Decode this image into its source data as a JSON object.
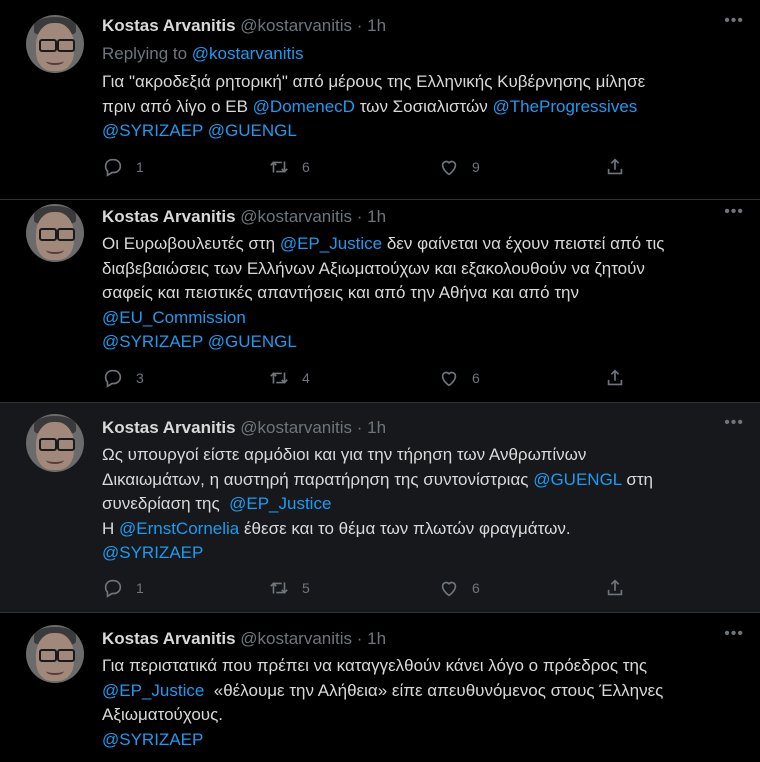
{
  "tweets": [
    {
      "name": "Kostas Arvanitis",
      "handle": "@kostarvanitis",
      "time": "1h",
      "replying_label": "Replying to",
      "replying_to": "@kostarvanitis",
      "lines": [
        [
          "Για \"ακροδεξιά ρητορική\" από μέρους της Ελληνικής Κυβέρνησης μίλησε"
        ],
        [
          "πριν από λίγο ο ΕΒ ",
          "@DomenecD",
          " των Σοσιαλιστών ",
          "@TheProgressives"
        ],
        [
          "",
          "@SYRIZAEP",
          " ",
          "@GUENGL"
        ]
      ],
      "replies": "1",
      "retweets": "6",
      "likes": "9"
    },
    {
      "name": "Kostas Arvanitis",
      "handle": "@kostarvanitis",
      "time": "1h",
      "lines": [
        [
          "Οι Ευρωβουλευτές στη ",
          "@EP_Justice",
          " δεν φαίνεται να έχουν πειστεί από τις"
        ],
        [
          "διαβεβαιώσεις των Ελλήνων Αξιωματούχων και εξακολουθούν να ζητούν"
        ],
        [
          "σαφείς και πειστικές απαντήσεις και από την Αθήνα και από την"
        ],
        [
          "",
          "@EU_Commission"
        ],
        [
          "",
          "@SYRIZAEP",
          " ",
          "@GUENGL"
        ]
      ],
      "replies": "3",
      "retweets": "4",
      "likes": "6"
    },
    {
      "name": "Kostas Arvanitis",
      "handle": "@kostarvanitis",
      "time": "1h",
      "lines": [
        [
          "Ως υπουργοί είστε αρμόδιοι και για την τήρηση των Ανθρωπίνων"
        ],
        [
          "Δικαιωμάτων, η αυστηρή παρατήρηση της συντονίστριας ",
          "@GUENGL",
          " στη"
        ],
        [
          "συνεδρίαση της  ",
          "@EP_Justice"
        ],
        [
          "Η ",
          "@ErnstCornelia",
          " έθεσε και το θέμα των πλωτών φραγμάτων."
        ],
        [
          "",
          "@SYRIZAEP"
        ]
      ],
      "replies": "1",
      "retweets": "5",
      "likes": "6"
    },
    {
      "name": "Kostas Arvanitis",
      "handle": "@kostarvanitis",
      "time": "1h",
      "lines": [
        [
          "Για περιστατικά που πρέπει να καταγγελθούν κάνει λόγο ο πρόεδρος της"
        ],
        [
          "",
          "@EP_Justice",
          "  «θέλουμε την Αλήθεια» είπε απευθυνόμενος στους Έλληνες"
        ],
        [
          "Αξιωματούχους."
        ],
        [
          "",
          "@SYRIZAEP"
        ]
      ]
    }
  ],
  "colors": {
    "background": "#000000",
    "highlight": "#16181c",
    "link": "#1d9bf0",
    "muted": "#6e767d",
    "text": "#d9d9d9"
  },
  "icons": [
    "reply-icon",
    "retweet-icon",
    "like-icon",
    "share-icon",
    "more-icon"
  ]
}
